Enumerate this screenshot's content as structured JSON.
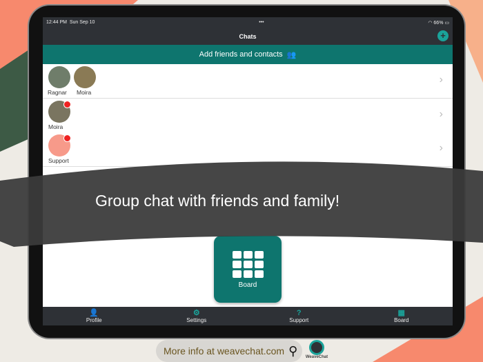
{
  "status": {
    "time": "12:44 PM",
    "date": "Sun Sep 10",
    "dots": "•••",
    "battery": "66%"
  },
  "nav": {
    "title": "Chats",
    "new_chat_icon": "+"
  },
  "banner": {
    "label": "Add friends and contacts"
  },
  "chats": [
    {
      "members": [
        "Ragnar",
        "Moira"
      ],
      "unread": false
    },
    {
      "members": [
        "Moira"
      ],
      "unread": true
    },
    {
      "members": [
        "Support"
      ],
      "unread": true
    }
  ],
  "board_button": {
    "label": "Board"
  },
  "headline": "Group chat with friends and family!",
  "tabs": [
    {
      "label": "Profile",
      "icon": "profile-icon"
    },
    {
      "label": "Settings",
      "icon": "gear-icon"
    },
    {
      "label": "Support",
      "icon": "question-icon"
    },
    {
      "label": "Board",
      "icon": "grid-icon"
    }
  ],
  "footer": {
    "more_info": "More info at weavechat.com",
    "logo_text": "WeaveChat"
  },
  "colors": {
    "teal": "#0e756e",
    "accent": "#1aa39a",
    "dark": "#2e3136",
    "coral": "#f7896d"
  }
}
